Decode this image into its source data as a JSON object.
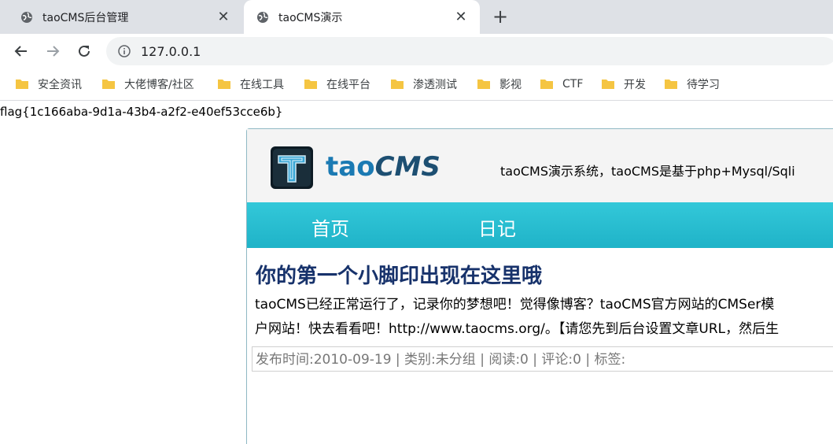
{
  "browser": {
    "tabs": [
      {
        "title": "taoCMS后台管理",
        "close": "✕"
      },
      {
        "title": "taoCMS演示",
        "close": "✕"
      }
    ],
    "new_tab": "+",
    "url": "127.0.0.1",
    "bookmarks": [
      "安全资讯",
      "大佬博客/社区",
      "在线工具",
      "在线平台",
      "渗透测试",
      "影视",
      "CTF",
      "开发",
      "待学习"
    ],
    "colors": {
      "tabstrip": "#dee1e6",
      "folder": "#f5c542"
    }
  },
  "page": {
    "flag": "flag{1c166aba-9d1a-43b4-a2f2-e40ef53cce6b}",
    "logo": {
      "tao": "tao",
      "cms": "CMS"
    },
    "tagline": "taoCMS演示系统，taoCMS是基于php+Mysql/Sqli",
    "nav": [
      "首页",
      "日记"
    ],
    "post": {
      "title": "你的第一个小脚印出现在这里哦",
      "line1": "taoCMS已经正常运行了，记录你的梦想吧！觉得像博客？taoCMS官方网站的CMSer模",
      "line2": "户网站！快去看看吧！http://www.taocms.org/。【请您先到后台设置文章URL，然后生",
      "meta": "发布时间:2010-09-19 | 类别:未分组 | 阅读:0 | 评论:0 | 标签:"
    },
    "colors": {
      "nav": "#2ab9cd",
      "title": "#17326b"
    }
  }
}
